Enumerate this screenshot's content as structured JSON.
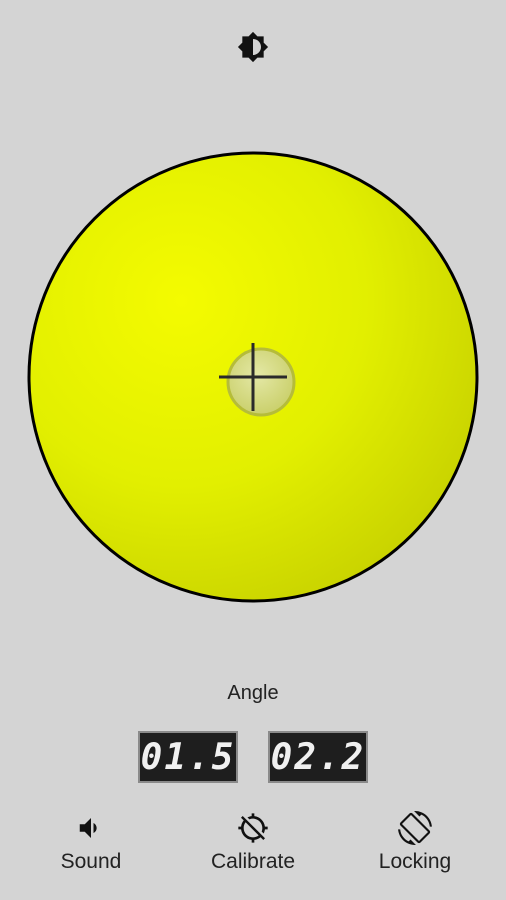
{
  "icons": {
    "brightness": "brightness-icon",
    "sound": "volume-icon",
    "calibrate": "gps-off-icon",
    "locking": "screen-rotation-icon"
  },
  "colors": {
    "background": "#d4d4d4",
    "bubble_fill": "#e2ef00",
    "bubble_highlight": "#f4fb00",
    "bubble_shadow": "#c8d200",
    "crosshair": "#2a2a2a",
    "lcd_background": "#1e1e1e",
    "lcd_text": "#f0f0f0"
  },
  "angle": {
    "label": "Angle",
    "x_value": "01.5",
    "y_value": "02.2"
  },
  "controls": {
    "sound_label": "Sound",
    "calibrate_label": "Calibrate",
    "locking_label": "Locking"
  }
}
